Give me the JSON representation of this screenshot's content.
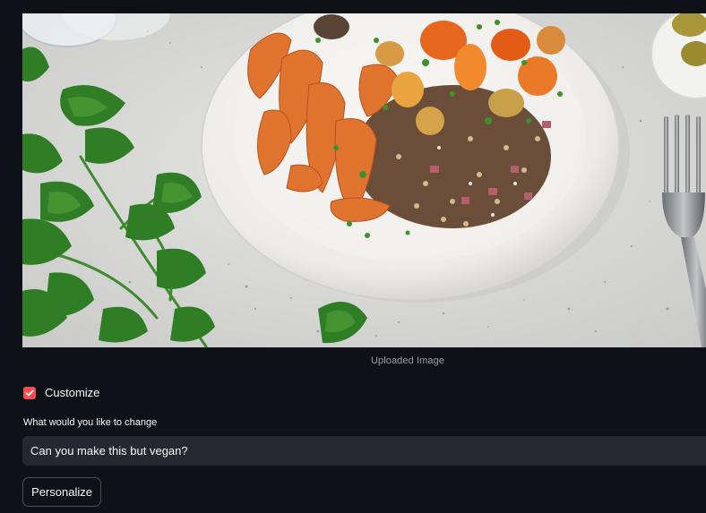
{
  "image": {
    "caption": "Uploaded Image"
  },
  "customize": {
    "label": "Customize",
    "checked": true,
    "check_icon": "check-icon",
    "accent_color": "#ff4b4b"
  },
  "change_field": {
    "label": "What would you like to change",
    "value": "Can you make this but vegan?"
  },
  "personalize_button": {
    "label": "Personalize"
  },
  "colors": {
    "background": "#0e1117",
    "input_background": "#262730",
    "text": "#fafafa",
    "muted_text": "#9a9da5"
  }
}
